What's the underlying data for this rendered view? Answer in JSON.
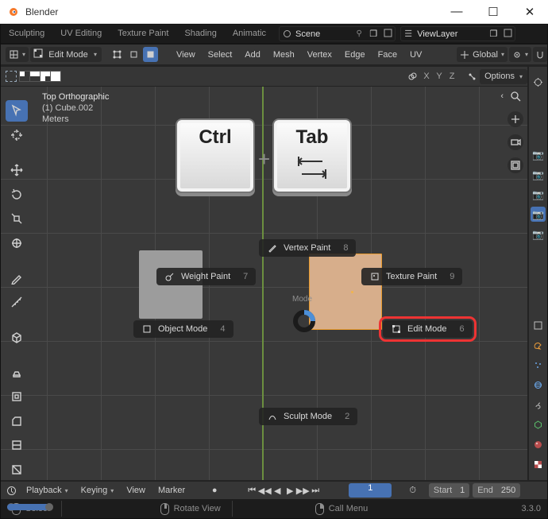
{
  "window": {
    "title": "Blender",
    "minimize": "—",
    "maximize": "☐",
    "close": "✕"
  },
  "top_tabs": {
    "sculpting": "Sculpting",
    "uv": "UV Editing",
    "tex": "Texture Paint",
    "shading": "Shading",
    "anim": "Animatic"
  },
  "scene": {
    "label": "Scene"
  },
  "viewlayer": {
    "label": "ViewLayer"
  },
  "viewport_header": {
    "mode": "Edit Mode",
    "menus": {
      "view": "View",
      "select": "Select",
      "add": "Add",
      "mesh": "Mesh",
      "vertex": "Vertex",
      "edge": "Edge",
      "face": "Face",
      "uv": "UV"
    },
    "orientation": "Global"
  },
  "subbar": {
    "axes": {
      "x": "X",
      "y": "Y",
      "z": "Z"
    },
    "options": "Options"
  },
  "overlay": {
    "title": "Top Orthographic",
    "line2": "(1) Cube.002",
    "line3": "Meters"
  },
  "keys": {
    "ctrl": "Ctrl",
    "tab": "Tab",
    "plus": "+"
  },
  "pie": {
    "vertex_paint": {
      "label": "Vertex Paint",
      "num": "8"
    },
    "weight_paint": {
      "label": "Weight Paint",
      "num": "7"
    },
    "texture_paint": {
      "label": "Texture Paint",
      "num": "9"
    },
    "object_mode": {
      "label": "Object Mode",
      "num": "4"
    },
    "edit_mode": {
      "label": "Edit Mode",
      "num": "6"
    },
    "sculpt_mode": {
      "label": "Sculpt Mode",
      "num": "2"
    },
    "mode_label": "Mode"
  },
  "right_edge_icons": [
    "settings",
    "camera",
    "camera",
    "camera",
    "camera-sel",
    "camera"
  ],
  "timeline": {
    "playback": "Playback",
    "keying": "Keying",
    "view": "View",
    "marker": "Marker",
    "frame": "1",
    "start_lbl": "Start",
    "start": "1",
    "end_lbl": "End",
    "end": "250"
  },
  "status": {
    "select": "Select",
    "rotate": "Rotate View",
    "callmenu": "Call Menu",
    "version": "3.3.0"
  }
}
